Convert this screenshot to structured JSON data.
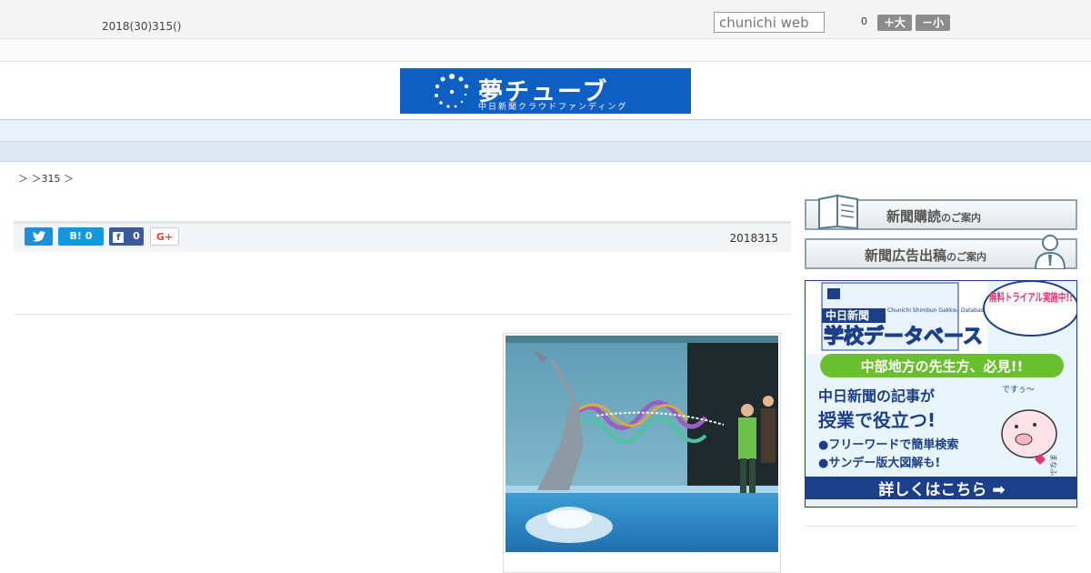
{
  "header": {
    "date": "2018(30)315()",
    "search_placeholder": "chunichi web",
    "font_count": "0",
    "font_large_label": "＋大",
    "font_small_label": "－小"
  },
  "logo": {
    "title": "夢チューブ",
    "subtitle": "中日新聞クラウドファンディング"
  },
  "nav": {
    "items": [
      "",
      "",
      "",
      "",
      "",
      "",
      "",
      "",
      ""
    ]
  },
  "breadcrumb": "＞ ＞315 ＞",
  "share": {
    "hatena_label": "B! 0",
    "facebook_count": "0",
    "gplus_label": "G+",
    "published": "2018315"
  },
  "sidebar": {
    "subscribe_main": "新聞購読",
    "subscribe_sub": "のご案内",
    "advertise_main": "新聞広告出稿",
    "advertise_sub": "のご案内"
  },
  "ad": {
    "brand": "中日新聞",
    "title": "学校データベース",
    "tagline_en": "Chunichi Shimbun Gakkou Database",
    "trial": "無料トライアル実施中!!",
    "banner": "中部地方の先生方、必見!!",
    "headline1": "中日新聞の記事が",
    "headline2": "授業で役立つ!",
    "bullet1": "●フリーワードで簡単検索",
    "bullet2": "●サンデー版大図解も!",
    "mascot_speech": "ですぅ〜",
    "mascot_name": "まなふぅ",
    "cta": "詳しくはこちら ➡"
  },
  "colors": {
    "logo_bg": "#0d5fc2",
    "nav_bg": "#e8f0f8",
    "twitter": "#1f8fd9",
    "hatena": "#1597dd",
    "facebook": "#3b5a9a",
    "ad_navy": "#1c3f8a",
    "ad_green": "#6abf2e"
  }
}
